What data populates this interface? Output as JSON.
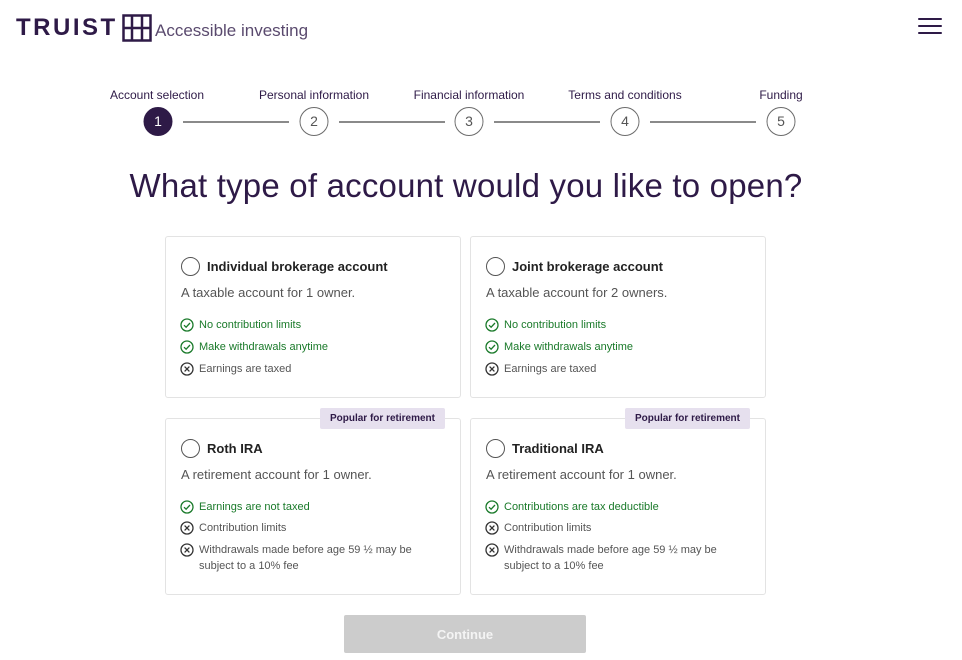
{
  "header": {
    "brand": "TRUIST",
    "tagline": "Accessible investing",
    "menu_icon": "hamburger-menu-icon"
  },
  "stepper": {
    "steps": [
      {
        "label": "Account selection",
        "number": "1",
        "active": true
      },
      {
        "label": "Personal information",
        "number": "2",
        "active": false
      },
      {
        "label": "Financial information",
        "number": "3",
        "active": false
      },
      {
        "label": "Terms and conditions",
        "number": "4",
        "active": false
      },
      {
        "label": "Funding",
        "number": "5",
        "active": false
      }
    ]
  },
  "page_title": "What type of account would you like to open?",
  "accounts": [
    {
      "title": "Individual brokerage account",
      "description": "A taxable account for 1 owner.",
      "badge": "",
      "features": [
        {
          "text": "No contribution limits",
          "type": "check-circle-icon"
        },
        {
          "text": "Make withdrawals anytime",
          "type": "check-circle-icon"
        },
        {
          "text": "Earnings are taxed",
          "type": "x-circle-icon"
        }
      ]
    },
    {
      "title": "Joint brokerage account",
      "description": "A taxable account for 2 owners.",
      "badge": "",
      "features": [
        {
          "text": "No contribution limits",
          "type": "check-circle-icon"
        },
        {
          "text": "Make withdrawals anytime",
          "type": "check-circle-icon"
        },
        {
          "text": "Earnings are taxed",
          "type": "x-circle-icon"
        }
      ]
    },
    {
      "title": "Roth IRA",
      "description": "A retirement account for 1 owner.",
      "badge": "Popular for retirement",
      "features": [
        {
          "text": "Earnings are not taxed",
          "type": "check-circle-icon"
        },
        {
          "text": "Contribution limits",
          "type": "x-circle-icon"
        },
        {
          "text": "Withdrawals made before age 59 ½ may be",
          "text2": "subject to a 10% fee",
          "type": "x-circle-icon"
        }
      ]
    },
    {
      "title": "Traditional IRA",
      "description": "A retirement account for 1 owner.",
      "badge": "Popular for retirement",
      "features": [
        {
          "text": "Contributions are tax deductible",
          "type": "check-circle-icon"
        },
        {
          "text": "Contribution limits",
          "type": "x-circle-icon"
        },
        {
          "text": "Withdrawals made before age 59 ½ may be",
          "text2": "subject to a 10% fee",
          "type": "x-circle-icon"
        }
      ]
    }
  ],
  "continue_label": "Continue",
  "colors": {
    "brand": "#2e1a47",
    "positive": "#1a7a2a",
    "badge_bg": "#e6e0ee",
    "disabled_button": "#cccccc"
  }
}
